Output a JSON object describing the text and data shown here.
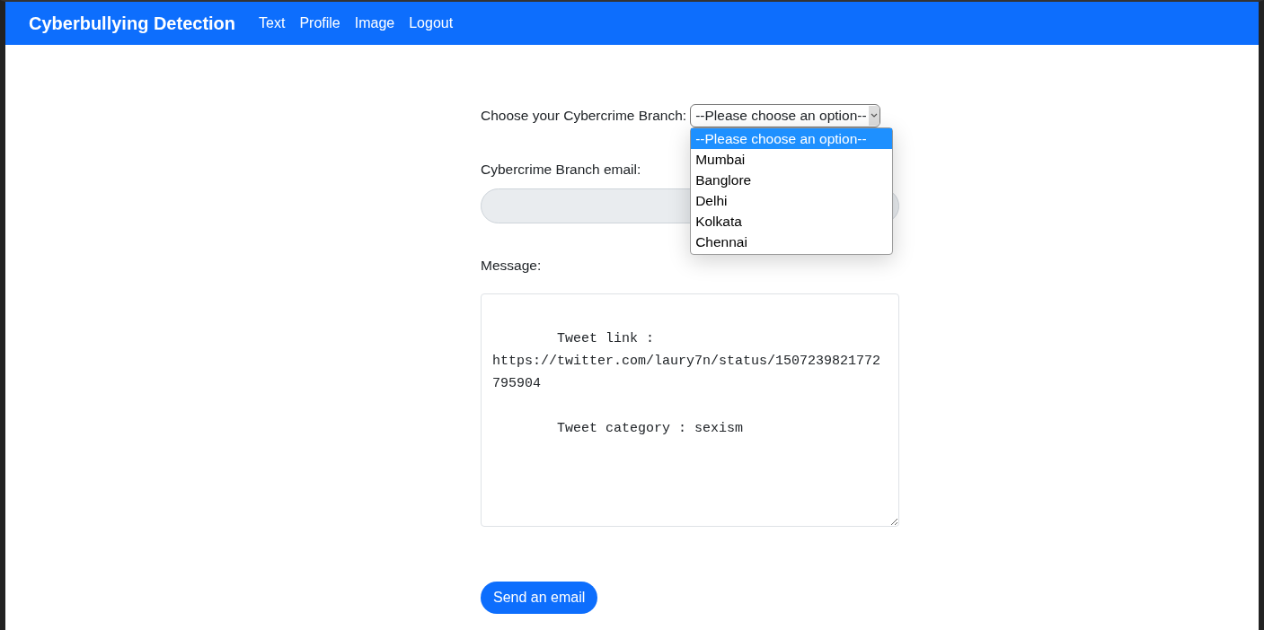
{
  "navbar": {
    "brand": "Cyberbullying Detection",
    "links": [
      {
        "label": "Text"
      },
      {
        "label": "Profile"
      },
      {
        "label": "Image"
      },
      {
        "label": "Logout"
      }
    ]
  },
  "form": {
    "branch_label": "Choose your Cybercrime Branch:",
    "branch_select": {
      "value": "--Please choose an option--",
      "expanded": true,
      "options": [
        {
          "label": "--Please choose an option--",
          "selected": true
        },
        {
          "label": "Mumbai",
          "selected": false
        },
        {
          "label": "Banglore",
          "selected": false
        },
        {
          "label": "Delhi",
          "selected": false
        },
        {
          "label": "Kolkata",
          "selected": false
        },
        {
          "label": "Chennai",
          "selected": false
        }
      ]
    },
    "email_label": "Cybercrime Branch email:",
    "email_field": {
      "disabled": true
    },
    "message_label": "Message:",
    "message_field": {
      "value": "\n        Tweet link : https://twitter.com/laury7n/status/1507239821772795904\n\n        Tweet category : sexism"
    },
    "submit_button": "Send an email"
  }
}
